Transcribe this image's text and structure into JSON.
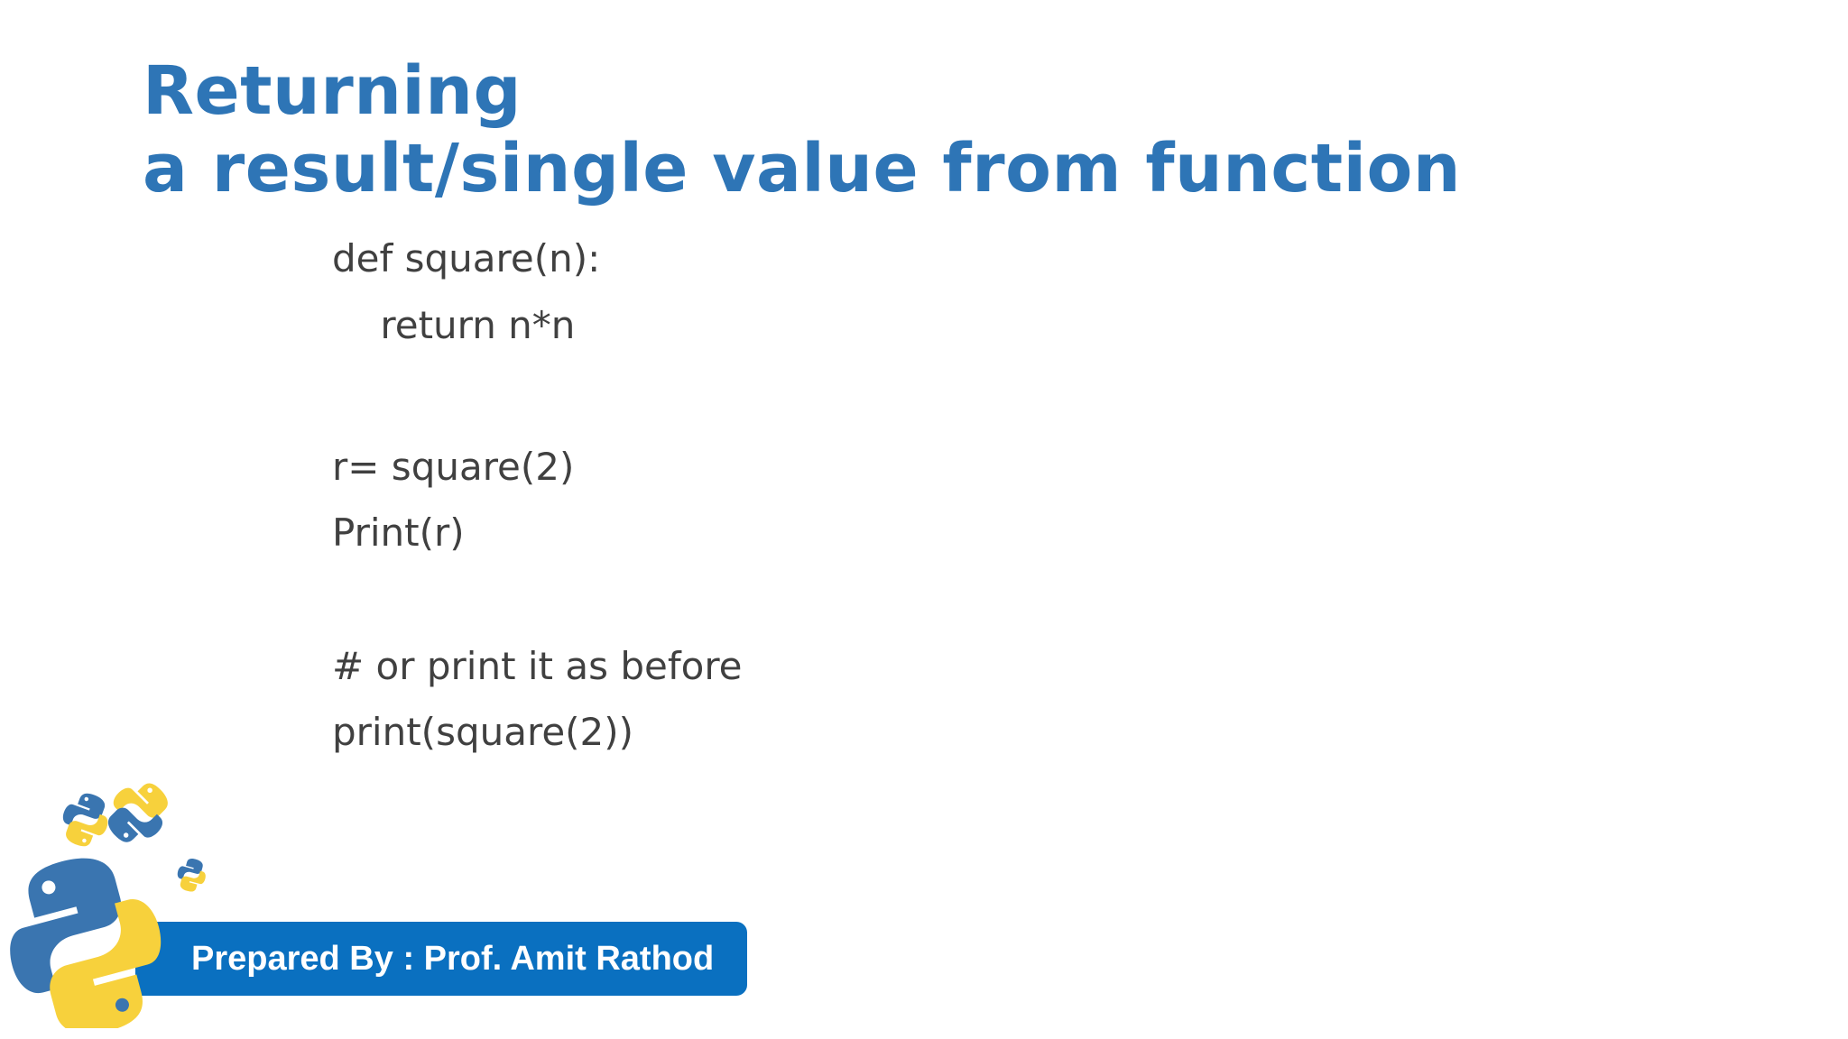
{
  "slide": {
    "title_line1": "Returning",
    "title_line2": "a result/single value from function",
    "code_lines": [
      "def square(n):",
      "    return n*n",
      "r= square(2)",
      "Print(r)",
      "# or print it as before",
      "print(square(2))"
    ],
    "footer_text": "Prepared By : Prof. Amit Rathod"
  },
  "colors": {
    "title": "#2e75b6",
    "code_text": "#404040",
    "banner": "#0a70c0",
    "python_blue": "#3a75b0",
    "python_yellow": "#f7d13c"
  },
  "icons": {
    "logo": "python-logo-icon"
  }
}
